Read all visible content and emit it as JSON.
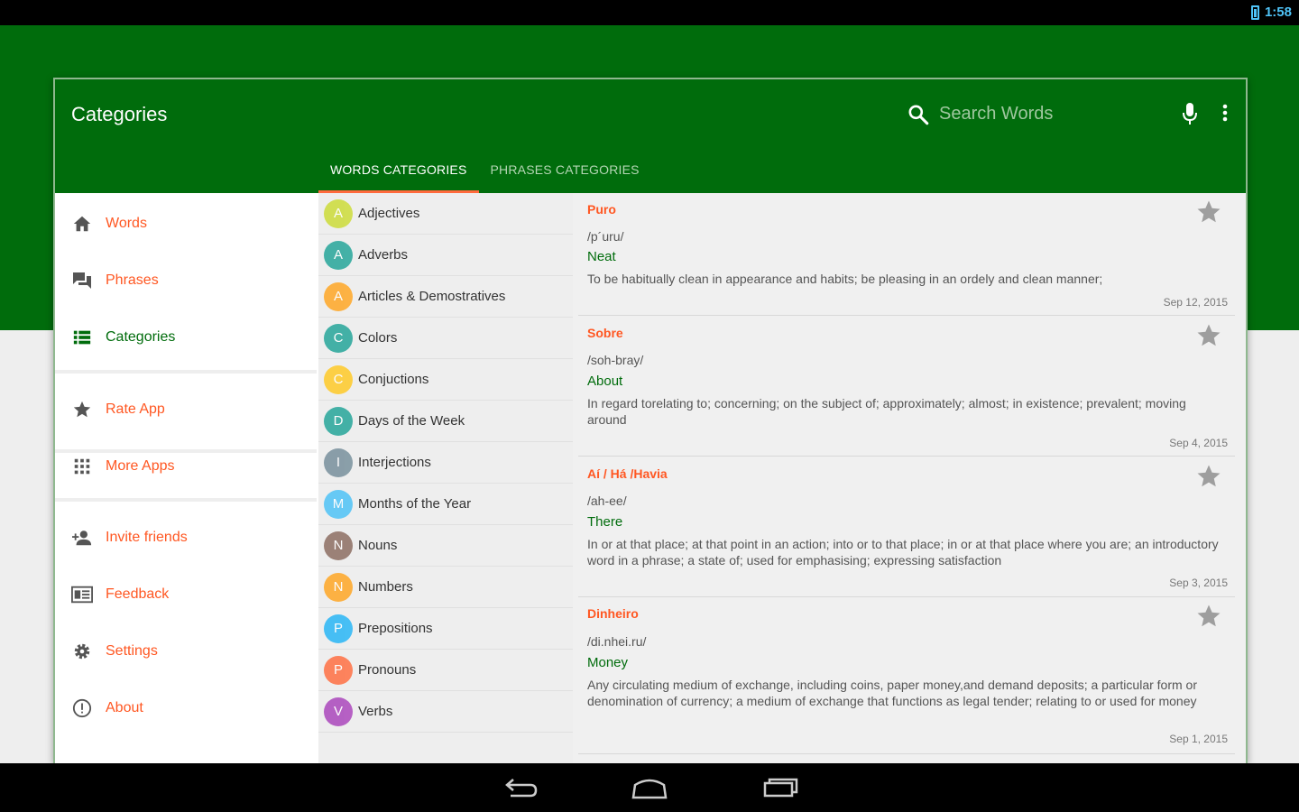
{
  "status_bar": {
    "time": "1:58"
  },
  "toolbar": {
    "title": "Categories",
    "search": {
      "placeholder": "Search Words",
      "value": ""
    },
    "tabs": [
      {
        "label": "WORDS CATEGORIES",
        "active": true
      },
      {
        "label": "PHRASES CATEGORIES",
        "active": false
      }
    ]
  },
  "drawer": {
    "items": [
      {
        "label": "Words",
        "icon": "home-icon"
      },
      {
        "label": "Phrases",
        "icon": "chat-icon"
      },
      {
        "label": "Categories",
        "icon": "list-icon",
        "active": true
      },
      {
        "label": "Rate App",
        "icon": "star-icon"
      },
      {
        "label": "More Apps",
        "icon": "apps-grid-icon"
      },
      {
        "label": "Invite friends",
        "icon": "add-person-icon"
      },
      {
        "label": "Feedback",
        "icon": "feedback-icon"
      },
      {
        "label": "Settings",
        "icon": "gear-icon"
      },
      {
        "label": "About",
        "icon": "info-icon"
      }
    ]
  },
  "categories": [
    {
      "letter": "A",
      "label": "Adjectives",
      "color": "#cddc39"
    },
    {
      "letter": "A",
      "label": "Adverbs",
      "color": "#26a69a"
    },
    {
      "letter": "A",
      "label": "Articles & Demostratives",
      "color": "#ffa726"
    },
    {
      "letter": "C",
      "label": "Colors",
      "color": "#26a69a"
    },
    {
      "letter": "C",
      "label": "Conjuctions",
      "color": "#ffca28"
    },
    {
      "letter": "D",
      "label": "Days of the Week",
      "color": "#26a69a"
    },
    {
      "letter": "I",
      "label": "Interjections",
      "color": "#78909c"
    },
    {
      "letter": "M",
      "label": "Months of the Year",
      "color": "#4fc3f7"
    },
    {
      "letter": "N",
      "label": "Nouns",
      "color": "#8d6e63"
    },
    {
      "letter": "N",
      "label": "Numbers",
      "color": "#ffa726"
    },
    {
      "letter": "P",
      "label": "Prepositions",
      "color": "#29b6f6"
    },
    {
      "letter": "P",
      "label": "Pronouns",
      "color": "#ff7043"
    },
    {
      "letter": "V",
      "label": "Verbs",
      "color": "#ab47bc"
    }
  ],
  "words": [
    {
      "word": "Puro",
      "phonetic": "/p´uru/",
      "translation": "Neat",
      "definition": "To be habitually clean in appearance and habits; be pleasing in an ordely and clean manner;",
      "date": "Sep 12, 2015"
    },
    {
      "word": "Sobre",
      "phonetic": "/soh-bray/",
      "translation": "About",
      "definition": "In regard torelating to; concerning; on the subject of; approximately; almost; in existence; prevalent; moving around",
      "date": "Sep 4, 2015"
    },
    {
      "word": "Aí / Há /Havia",
      "phonetic": "/ah-ee/",
      "translation": "There",
      "definition": "In or at that place; at that point in an action; into or to that place;  in or at that place where you are; an introductory word in a phrase;  a state of; used for emphasising; expressing satisfaction",
      "date": "Sep 3, 2015"
    },
    {
      "word": "Dinheiro",
      "phonetic": "/di.nhei.ru/",
      "translation": "Money",
      "definition": "Any circulating medium of exchange, including coins, paper money,and demand deposits; a particular form or denomination of currency; a medium of exchange that functions as legal tender; relating to or used for money",
      "date": "Sep 1, 2015"
    }
  ],
  "colors": {
    "primary": "#006c0c",
    "accent": "#ff5722"
  }
}
